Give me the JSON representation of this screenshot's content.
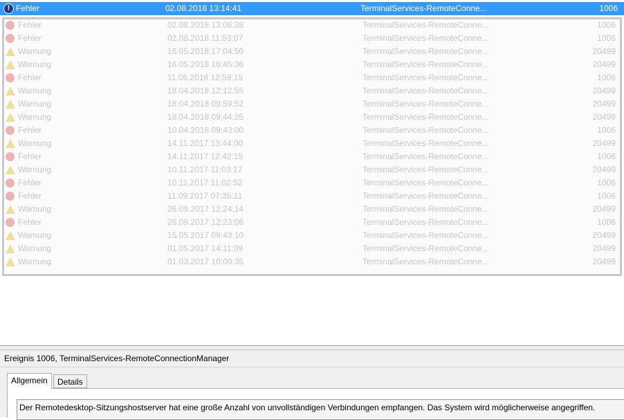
{
  "selected_event": {
    "level": "Fehler",
    "date": "02.08.2018 13:14:41",
    "source": "TerminalServices-RemoteConne...",
    "id": "1006",
    "icon": "error-icon"
  },
  "faded_events": [
    {
      "level": "Fehler",
      "date": "02.08.2018 13:06:28",
      "source": "TerminalServices-RemoteConne...",
      "id": "1006"
    },
    {
      "level": "Fehler",
      "date": "02.08.2018 11:53:07",
      "source": "TerminalServices-RemoteConne...",
      "id": "1006"
    },
    {
      "level": "Warnung",
      "date": "16.05.2018 17:04:50",
      "source": "TerminalServices-RemoteConne...",
      "id": "20499"
    },
    {
      "level": "Warnung",
      "date": "16.05.2018 16:45:36",
      "source": "TerminalServices-RemoteConne...",
      "id": "20499"
    },
    {
      "level": "Fehler",
      "date": "11.05.2018 12:59:15",
      "source": "TerminalServices-RemoteConne...",
      "id": "1006"
    },
    {
      "level": "Warnung",
      "date": "18.04.2018 12:12:55",
      "source": "TerminalServices-RemoteConne...",
      "id": "20499"
    },
    {
      "level": "Warnung",
      "date": "18.04.2018 09:59:52",
      "source": "TerminalServices-RemoteConne...",
      "id": "20499"
    },
    {
      "level": "Warnung",
      "date": "18.04.2018 09:44:25",
      "source": "TerminalServices-RemoteConne...",
      "id": "20499"
    },
    {
      "level": "Fehler",
      "date": "10.04.2018 09:43:00",
      "source": "TerminalServices-RemoteConne...",
      "id": "1006"
    },
    {
      "level": "Warnung",
      "date": "14.11.2017 13:44:00",
      "source": "TerminalServices-RemoteConne...",
      "id": "20499"
    },
    {
      "level": "Fehler",
      "date": "14.11.2017 12:42:15",
      "source": "TerminalServices-RemoteConne...",
      "id": "1006"
    },
    {
      "level": "Warnung",
      "date": "10.11.2017 11:03:17",
      "source": "TerminalServices-RemoteConne...",
      "id": "20499"
    },
    {
      "level": "Fehler",
      "date": "10.11.2017 11:02:52",
      "source": "TerminalServices-RemoteConne...",
      "id": "1006"
    },
    {
      "level": "Fehler",
      "date": "11.09.2017 07:35:11",
      "source": "TerminalServices-RemoteConne...",
      "id": "1006"
    },
    {
      "level": "Warnung",
      "date": "26.09.2017 12:24:14",
      "source": "TerminalServices-RemoteConne...",
      "id": "20499"
    },
    {
      "level": "Fehler",
      "date": "26.09.2017 12:23:06",
      "source": "TerminalServices-RemoteConne...",
      "id": "1006"
    },
    {
      "level": "Warnung",
      "date": "15.05.2017 09:43:10",
      "source": "TerminalServices-RemoteConne...",
      "id": "20499"
    },
    {
      "level": "Warnung",
      "date": "01.05.2017 14:11:09",
      "source": "TerminalServices-RemoteConne...",
      "id": "20499"
    },
    {
      "level": "Warnung",
      "date": "01.03.2017 10:00:35",
      "source": "TerminalServices-RemoteConne...",
      "id": "20499"
    }
  ],
  "details": {
    "title": "Ereignis 1006, TerminalServices-RemoteConnectionManager",
    "tabs": [
      "Allgemein",
      "Details"
    ],
    "description": "Der Remotedesktop-Sitzungshostserver hat eine große Anzahl von unvollständigen Verbindungen empfangen. Das System wird möglicherweise angegriffen."
  },
  "colors": {
    "selection": "#3399ff",
    "error": "#c0392b",
    "warning": "#e8c94a"
  }
}
